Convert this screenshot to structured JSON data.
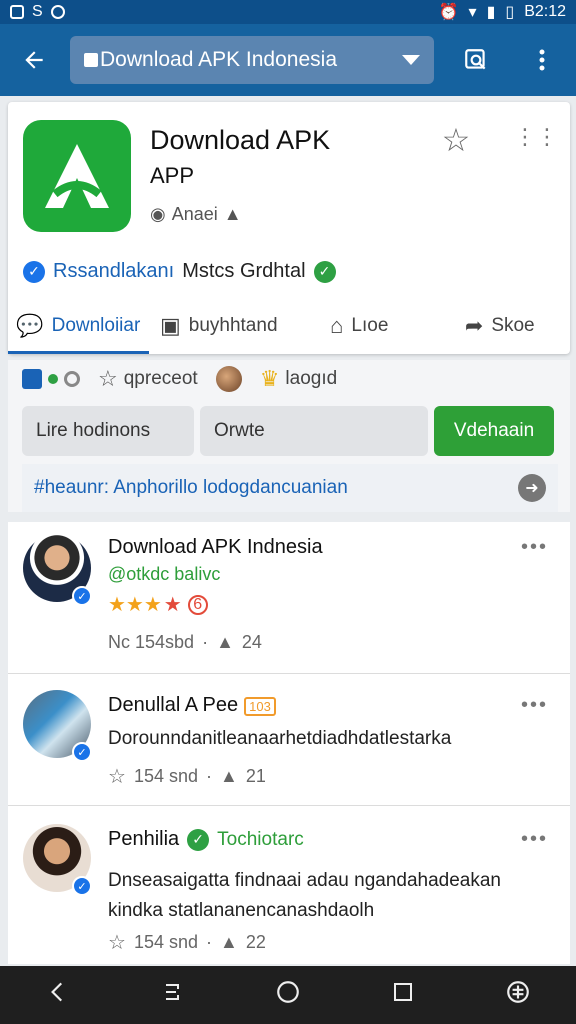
{
  "status_bar": {
    "time": "B2:12"
  },
  "app_bar": {
    "back_icon": "arrow-left-icon",
    "search_value": "Download APK Indonesia",
    "action_icons": [
      "search-window-icon",
      "more-vert-icon"
    ]
  },
  "app": {
    "title_line1": "Download APK",
    "title_line2": "APP",
    "developer": "Anaei",
    "verified_text": "Rssandlakanı",
    "verified_text2": "Mstcs Grdhtal",
    "brand_color": "#1fa93a",
    "accent_color": "#1a63b6"
  },
  "tabs": [
    {
      "label": "Downloiiar",
      "icon": "chat-bubble-icon"
    },
    {
      "label": "buyhhtand",
      "icon": "message-icon"
    },
    {
      "label": "Lıoe",
      "icon": "home-icon"
    },
    {
      "label": "Skoe",
      "icon": "share-icon"
    }
  ],
  "stats": {
    "item1": "qpreceot",
    "item2": "laogıd"
  },
  "buttons": {
    "btn1": "Lire hodinons",
    "btn2": "Orwte",
    "btn3": "Vdehaain"
  },
  "hashtag": "#heaunr: Anphorillo lodogdancuanian",
  "posts": [
    {
      "name": "Download APK Indnesia",
      "handle": "@otkdc balivc",
      "rating_badge": "6",
      "meta1": "Nc 154sbd",
      "meta2": "24"
    },
    {
      "name": "Denullal A Pee",
      "tag": "103",
      "text": "Dorounndanitleanaarhetdiadhdatlestarka",
      "meta1": "154 snd",
      "meta2": "21"
    },
    {
      "name": "Penhilia",
      "handle": "Tochiotarc",
      "text_line1": "Dnseasaigatta findnaai adau ngandahadeakan",
      "text_line2": "kindka statlananencanashdaolh",
      "meta1": "154 snd",
      "meta2": "22"
    }
  ]
}
